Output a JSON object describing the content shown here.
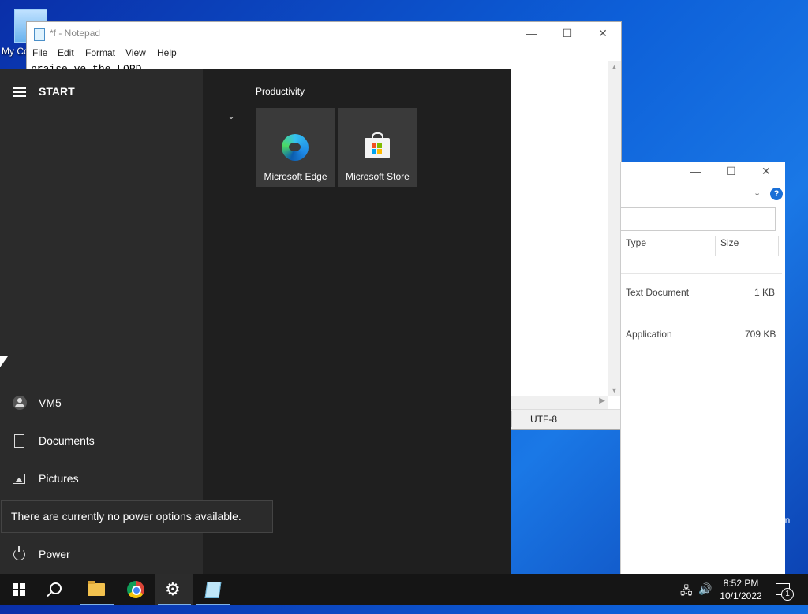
{
  "desktop": {
    "icon_label": "My Co"
  },
  "notepad": {
    "title": "*f - Notepad",
    "menu": [
      "File",
      "Edit",
      "Format",
      "View",
      "Help"
    ],
    "content": "praise ye the LORD",
    "encoding": "UTF-8"
  },
  "explorer": {
    "columns": [
      "Type",
      "Size"
    ],
    "rows": [
      {
        "type": "Text Document",
        "size": "1 KB"
      },
      {
        "type": "Application",
        "size": "709 KB"
      }
    ],
    "fragment": "in"
  },
  "start_menu": {
    "title": "START",
    "user": "VM5",
    "nav": [
      "Documents",
      "Pictures"
    ],
    "power": "Power",
    "group_label": "Productivity",
    "tiles": [
      {
        "label": "Microsoft Edge",
        "icon": "edge-icon"
      },
      {
        "label": "Microsoft Store",
        "icon": "store-icon"
      }
    ]
  },
  "tooltip": "There are currently no power options available.",
  "taskbar": {
    "apps": [
      "start-button",
      "search-icon",
      "file-explorer-icon",
      "chrome-icon",
      "settings-icon",
      "notepad-icon"
    ],
    "time": "8:52 PM",
    "date": "10/1/2022",
    "notification_count": "1"
  }
}
